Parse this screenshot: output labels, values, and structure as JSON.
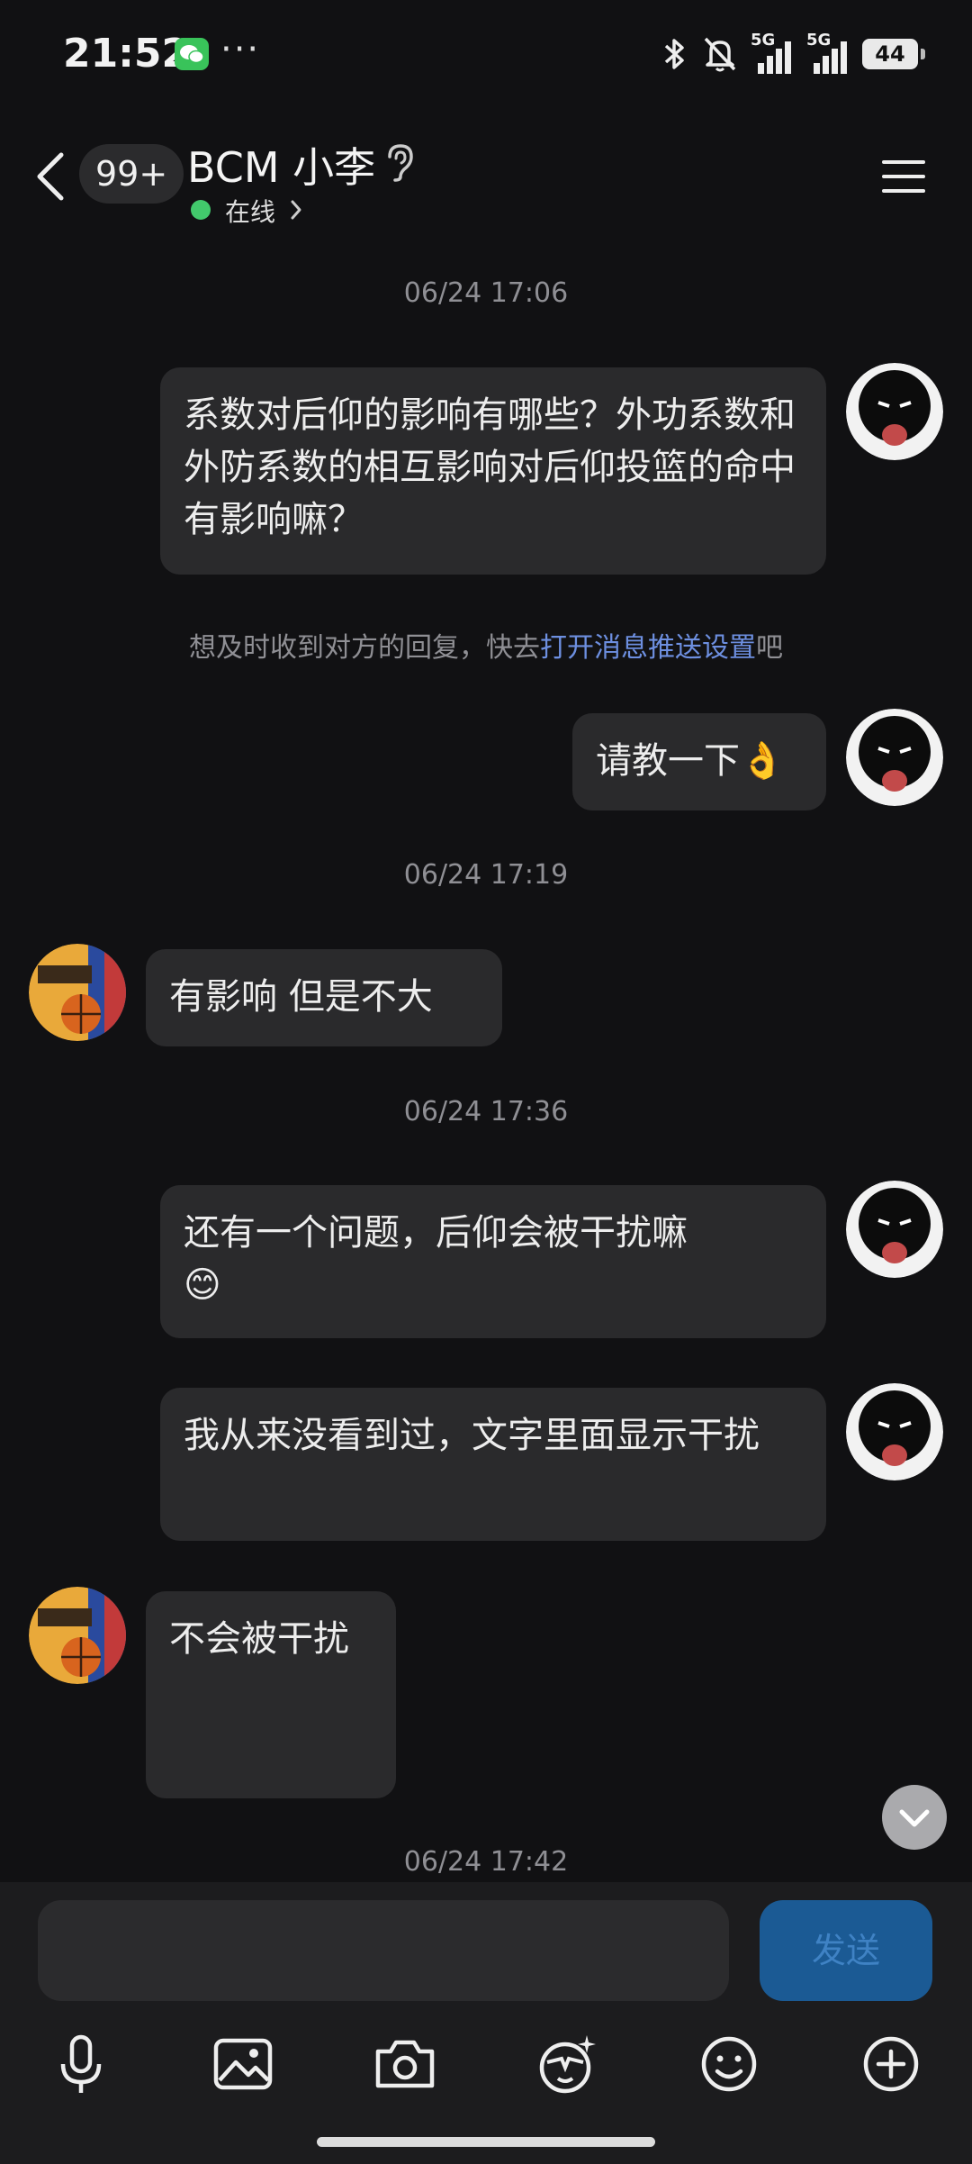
{
  "status_bar": {
    "time": "21:52",
    "more": "···",
    "network_1": "5G",
    "network_2": "5G",
    "battery": "44",
    "icons": [
      "wechat-icon",
      "bluetooth-icon",
      "mute-icon",
      "signal-icon",
      "battery-icon"
    ]
  },
  "header": {
    "unread_badge": "99+",
    "title": "BCM 小李",
    "online_status": "在线"
  },
  "messages": {
    "ts1": "06/24 17:06",
    "m1": "系数对后仰的影响有哪些？外功系数和外防系数的相互影响对后仰投篮的命中有影响嘛？",
    "tip_before": "想及时收到对方的回复，快去",
    "tip_link": "打开消息推送设置",
    "tip_after": "吧",
    "m2": "请教一下",
    "m2_emoji": "👌",
    "ts2": "06/24 17:19",
    "r1": "有影响 但是不大",
    "ts3": "06/24 17:36",
    "m3": "还有一个问题，后仰会被干扰嘛",
    "m3_emoji": "😊",
    "m4": "我从来没看到过，文字里面显示干扰",
    "r2": "不会被干扰",
    "ts4": "06/24 17:42"
  },
  "input": {
    "placeholder": "",
    "send_label": "发送"
  },
  "colors": {
    "background": "#111113",
    "bubble": "#2a2a2c",
    "online": "#42c96c",
    "link": "#6d8fe0",
    "send_button": "#1b5a94"
  }
}
